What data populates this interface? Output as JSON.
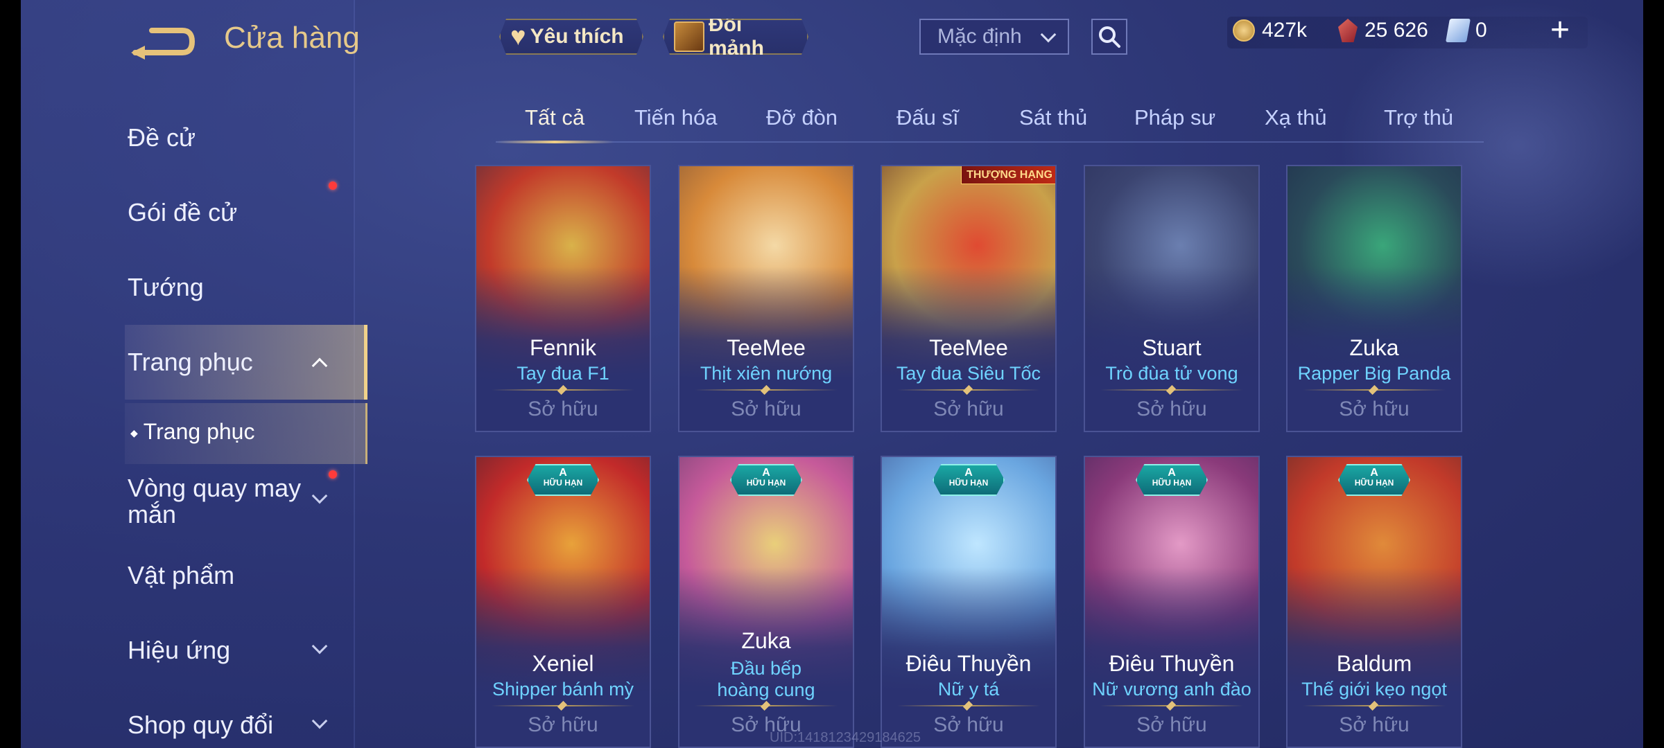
{
  "header": {
    "title": "Cửa hàng",
    "favorites_label": "Yêu thích",
    "shard_label": "Đổi mảnh",
    "sort_value": "Mặc định"
  },
  "currency": {
    "gold": "427k",
    "gems": "25 626",
    "tickets": "0"
  },
  "sidebar": {
    "items": [
      {
        "label": "Đề cử"
      },
      {
        "label": "Gói đề cử"
      },
      {
        "label": "Tướng"
      },
      {
        "label": "Trang phục"
      },
      {
        "label": "Trang phục"
      },
      {
        "label": "Vòng quay may mắn"
      },
      {
        "label": "Vật phẩm"
      },
      {
        "label": "Hiệu ứng"
      },
      {
        "label": "Shop quy đổi"
      }
    ]
  },
  "tabs": [
    "Tất cả",
    "Tiến hóa",
    "Đỡ đòn",
    "Đấu sĩ",
    "Sát thủ",
    "Pháp sư",
    "Xạ thủ",
    "Trợ thủ"
  ],
  "cards": [
    {
      "hero": "Fennik",
      "skin": "Tay đua F1",
      "status": "Sở hữu",
      "art_colors": [
        "#d9b24a",
        "#c23a2a",
        "#3a2c45"
      ]
    },
    {
      "hero": "TeeMee",
      "skin": "Thịt xiên nướng",
      "status": "Sở hữu",
      "art_colors": [
        "#f4d9a6",
        "#d88a3a",
        "#7a5036"
      ]
    },
    {
      "hero": "TeeMee",
      "skin": "Tay đua Siêu Tốc",
      "status": "Sở hữu",
      "art_colors": [
        "#e04a32",
        "#c9a14a",
        "#5a2c2a"
      ],
      "rank_badge": "THƯỢNG HẠNG"
    },
    {
      "hero": "Stuart",
      "skin": "Trò đùa tử vong",
      "status": "Sở hữu",
      "art_colors": [
        "#6b7fb0",
        "#3b4470",
        "#2a2f5a"
      ]
    },
    {
      "hero": "Zuka",
      "skin": "Rapper Big Panda",
      "status": "Sở hữu",
      "art_colors": [
        "#3aa67a",
        "#2a4a5a",
        "#1e2a4a"
      ]
    },
    {
      "hero": "Xeniel",
      "skin": "Shipper bánh mỳ",
      "status": "Sở hữu",
      "art_colors": [
        "#e8a23a",
        "#c22a2a",
        "#3a2430"
      ],
      "tier_badge": {
        "grade": "A",
        "text": "HỮU HẠN"
      }
    },
    {
      "hero": "Zuka",
      "skin": "Đầu bếp hoàng cung",
      "status": "Sở hữu",
      "art_colors": [
        "#e9cf7a",
        "#c65a9a",
        "#5a3a6a"
      ],
      "tier_badge": {
        "grade": "A",
        "text": "HỮU HẠN"
      }
    },
    {
      "hero": "Điêu Thuyền",
      "skin": "Nữ y tá",
      "status": "Sở hữu",
      "art_colors": [
        "#bfe6ff",
        "#6aa6e0",
        "#3a4c8a"
      ],
      "tier_badge": {
        "grade": "A",
        "text": "HỮU HẠN"
      }
    },
    {
      "hero": "Điêu Thuyền",
      "skin": "Nữ vương anh đào",
      "status": "Sở hữu",
      "art_colors": [
        "#e39ac6",
        "#8a3a7a",
        "#3a2456"
      ],
      "tier_badge": {
        "grade": "A",
        "text": "HỮU HẠN"
      }
    },
    {
      "hero": "Baldum",
      "skin": "Thế giới kẹo ngọt",
      "status": "Sở hữu",
      "art_colors": [
        "#e08a3a",
        "#c23a2a",
        "#4a2a2a"
      ],
      "tier_badge": {
        "grade": "A",
        "text": "HỮU HẠN"
      }
    }
  ],
  "watermark": "UID:1418123429184625"
}
